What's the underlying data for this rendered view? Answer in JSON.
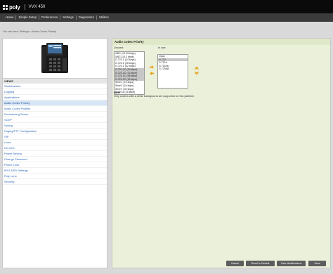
{
  "header": {
    "brand": "poly",
    "model": "VVX 450"
  },
  "nav": {
    "items": [
      "Home",
      "Simple Setup",
      "Preferences",
      "Settings",
      "Diagnostics",
      "Utilities"
    ]
  },
  "breadcrumb": "You are here: Settings > Audio Codec Priority",
  "sidebar": {
    "views_heading": "VIEWS",
    "items": [
      "Worldtraveler",
      "Logging",
      "Applications",
      "Audio Codec Priority",
      "Audio Codec Profiles",
      "Provisioning Server",
      "SCEP",
      "Syslog",
      "Paging/PTT Configuration",
      "SIP",
      "Lines",
      "UC-One",
      "Power Saving",
      "Change Password",
      "Phone Lock",
      "IPV4 DSD Settings",
      "Poly Lens",
      "Security"
    ],
    "active_index": 3
  },
  "main": {
    "section_title": "Audio Codec Priority",
    "unused_label": "Unused:",
    "inuse_label": "In use:",
    "unused": [
      {
        "label": "iLBC (13.33 kbps)",
        "gray": false
      },
      {
        "label": "iLBC (15.2 kbps)",
        "gray": false
      },
      {
        "label": "G.722.1 (24 kbps)",
        "gray": false
      },
      {
        "label": "G.722.1 (16 kbps)",
        "gray": false
      },
      {
        "label": "G.722.1 (32 kbps)",
        "gray": false
      },
      {
        "label": "G.722.1C (24 kbps)",
        "gray": true
      },
      {
        "label": "G.722.1C (32 kbps)",
        "gray": true
      },
      {
        "label": "G.722.1C (48 kbps)",
        "gray": true
      },
      {
        "label": "G.722.1C (32 kbps)",
        "gray": true
      },
      {
        "label": "Siren7 (16 kbps)",
        "gray": false
      },
      {
        "label": "Siren7 (24 kbps)",
        "gray": false
      },
      {
        "label": "Siren7 (32 kbps)",
        "gray": false
      },
      {
        "label": "Siren14 (24 kbps)",
        "gray": false
      }
    ],
    "in_use": [
      {
        "label": "Opus",
        "gray": false
      },
      {
        "label": "G.722",
        "gray": true
      },
      {
        "label": "G.711A",
        "gray": false
      },
      {
        "label": "G.711Mu",
        "gray": false
      },
      {
        "label": "G.729AB",
        "gray": false
      }
    ],
    "note_title": "Note",
    "note_text": "Only codecs with a white background are supported on this platform."
  },
  "footer": {
    "buttons": [
      "Cancel",
      "Reset to Default",
      "View Modifications",
      "Save"
    ]
  },
  "colors": {
    "topbar": "#0a0a0a",
    "navbar": "#3b3b3b",
    "panel_bg": "#eaf0da",
    "link": "#2a68b8",
    "arrow": "#e8a21a",
    "button": "#5d5d5d"
  }
}
